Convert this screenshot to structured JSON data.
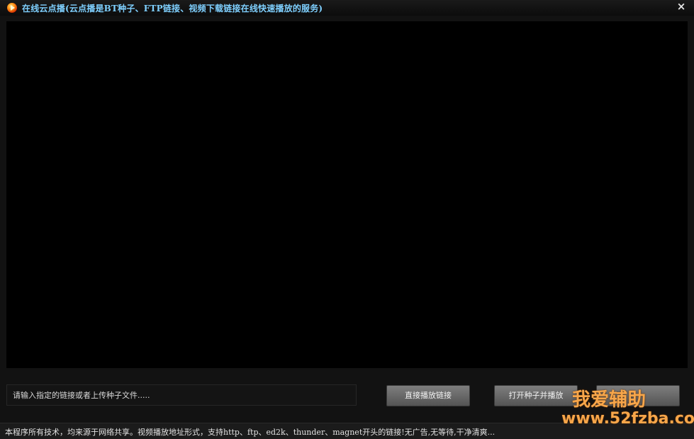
{
  "window": {
    "title": "在线云点播(云点播是BT种子、FTP链接、视频下载链接在线快速播放的服务)",
    "close_glyph": "×"
  },
  "controls": {
    "url_input_placeholder": "请输入指定的链接或者上传种子文件.....",
    "play_link_button": "直接播放链接",
    "open_torrent_button": "打开种子并播放",
    "third_button": ""
  },
  "status": {
    "text": "本程序所有技术，均来源于网络共享。视频播放地址形式，支持http、ftp、ed2k、thunder、magnet开头的链接!无广告,无等待,干净清爽..."
  },
  "watermark": {
    "line1": "我爱辅助",
    "line2": "www.52fzba.com"
  },
  "colors": {
    "title_text": "#7fd0ff",
    "watermark": "#f7a64a",
    "video_background": "#000000"
  },
  "icons": {
    "app": "play-orb-icon",
    "close": "close-icon"
  }
}
